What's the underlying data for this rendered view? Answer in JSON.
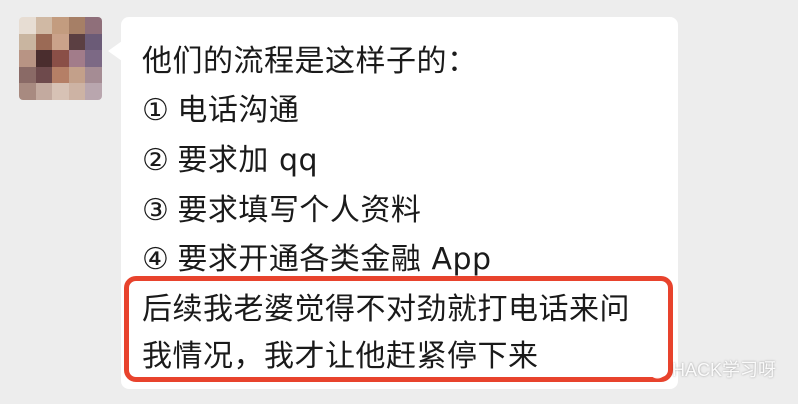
{
  "chat": {
    "message_lines": [
      {
        "marker": "",
        "text": "他们的流程是这样子的："
      },
      {
        "marker": "①",
        "text": "电话沟通"
      },
      {
        "marker": "②",
        "text": "要求加 qq"
      },
      {
        "marker": "③",
        "text": "要求填写个人资料"
      },
      {
        "marker": "④",
        "text": "要求开通各类金融 App"
      },
      {
        "marker": "",
        "text": "后续我老婆觉得不对劲就打电话来问"
      },
      {
        "marker": "",
        "text": "我情况，我才让他赶紧停下来"
      }
    ]
  },
  "watermark": {
    "text": "HACK学习呀",
    "icon": "wechat-icon"
  },
  "colors": {
    "background": "#ededed",
    "bubble": "#ffffff",
    "highlight": "#e8432d",
    "text": "#1a1a1a"
  }
}
